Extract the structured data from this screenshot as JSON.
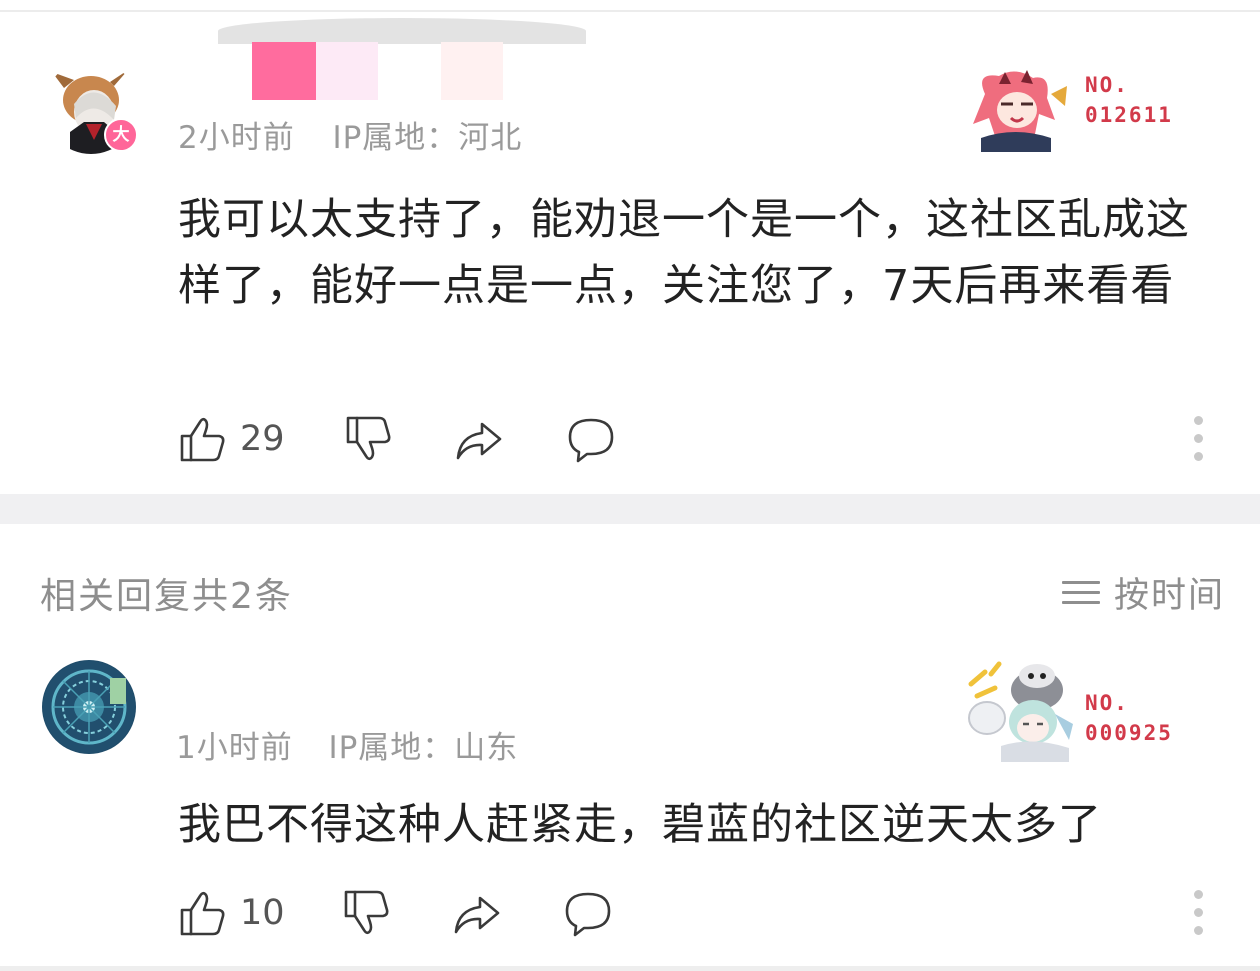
{
  "comment": {
    "time": "2小时前",
    "ip_label": "IP属地：",
    "ip_location": "河北",
    "level_badge": "大",
    "medal_line1": "NO.",
    "medal_line2": "012611",
    "text": "我可以太支持了，能劝退一个是一个，这社区乱成这样了，能好一点是一点，关注您了，7天后再来看看",
    "like_count": "29"
  },
  "replies_header": {
    "title": "相关回复共2条",
    "sort_label": "按时间"
  },
  "reply": {
    "time": "1小时前",
    "ip_label": "IP属地：",
    "ip_location": "山东",
    "medal_line1": "NO.",
    "medal_line2": "000925",
    "text": "我巴不得这种人赶紧走，碧蓝的社区逆天太多了",
    "like_count": "10"
  },
  "colors": {
    "accent_pink": "#ff6699",
    "medal_red": "#d23a4a",
    "meta_gray": "#9a9a9a",
    "divider": "#f0f0f2"
  }
}
